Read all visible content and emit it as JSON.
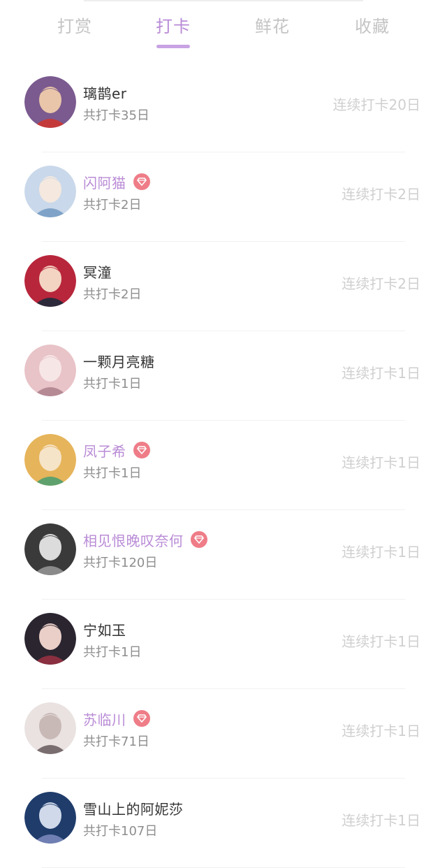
{
  "tabs": [
    {
      "label": "打赏",
      "active": false
    },
    {
      "label": "打卡",
      "active": true
    },
    {
      "label": "鲜花",
      "active": false
    },
    {
      "label": "收藏",
      "active": false
    }
  ],
  "colors": {
    "accent": "#b98bd6",
    "vip_badge": "#ee7d88",
    "text_primary": "#333333",
    "text_secondary": "#8e8e8e",
    "text_muted": "#cfcfcf"
  },
  "checkins": [
    {
      "name": "璃鹊er",
      "vip": false,
      "total": "共打卡35日",
      "streak": "连续打卡20日"
    },
    {
      "name": "闪阿猫",
      "vip": true,
      "total": "共打卡2日",
      "streak": "连续打卡2日"
    },
    {
      "name": "冥潼",
      "vip": false,
      "total": "共打卡2日",
      "streak": "连续打卡2日"
    },
    {
      "name": "一颗月亮糖",
      "vip": false,
      "total": "共打卡1日",
      "streak": "连续打卡1日"
    },
    {
      "name": "凤子希",
      "vip": true,
      "total": "共打卡1日",
      "streak": "连续打卡1日"
    },
    {
      "name": "相见恨晚叹奈何",
      "vip": true,
      "total": "共打卡120日",
      "streak": "连续打卡1日"
    },
    {
      "name": "宁如玉",
      "vip": false,
      "total": "共打卡1日",
      "streak": "连续打卡1日"
    },
    {
      "name": "苏临川",
      "vip": true,
      "total": "共打卡71日",
      "streak": "连续打卡1日"
    },
    {
      "name": "雪山上的阿妮莎",
      "vip": false,
      "total": "共打卡107日",
      "streak": "连续打卡1日"
    }
  ]
}
